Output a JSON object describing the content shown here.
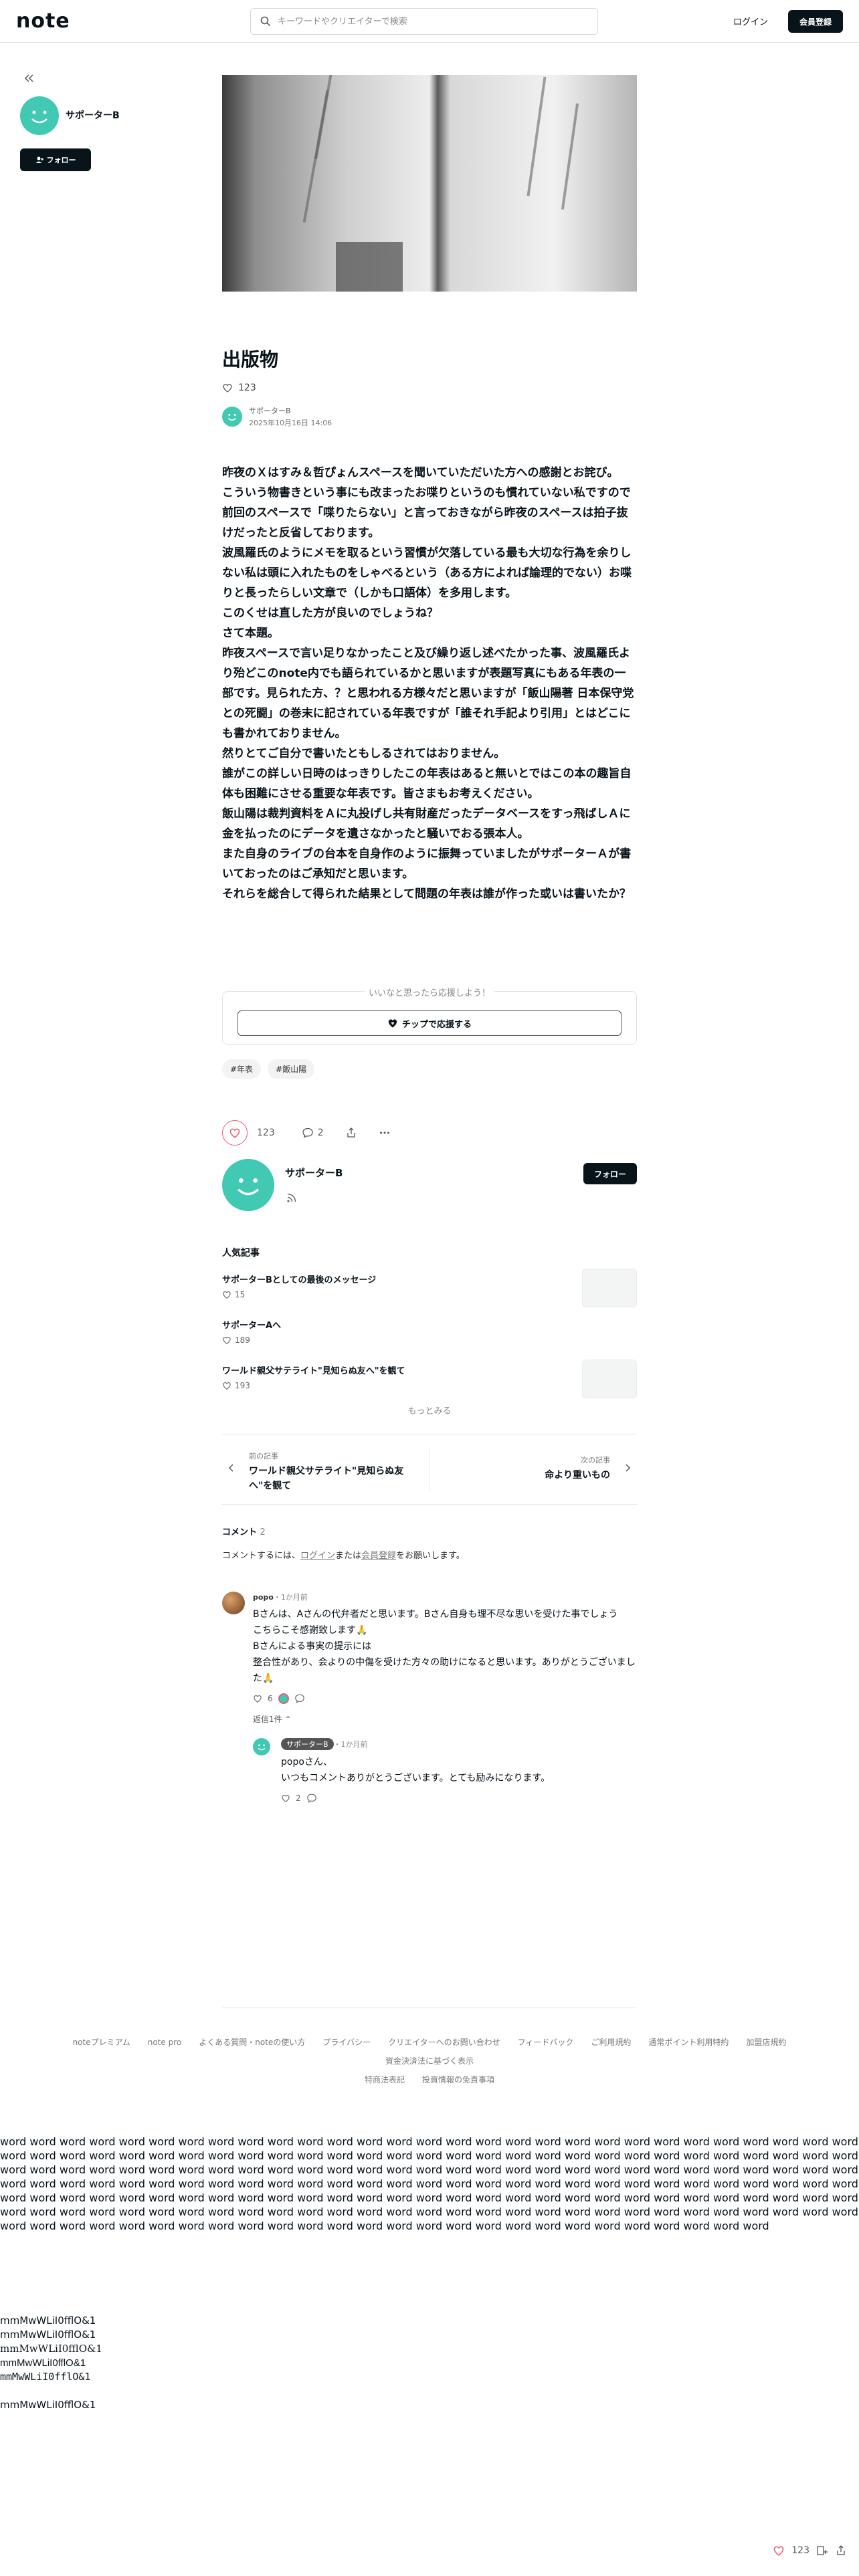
{
  "header": {
    "logo": "note",
    "search_placeholder": "キーワードやクリエイターで検索",
    "login": "ログイン",
    "signup": "会員登録"
  },
  "sidebar": {
    "creator_name": "サポーターB",
    "follow": "フォロー"
  },
  "article": {
    "title": "出版物",
    "likes": "123",
    "author": "サポーターB",
    "date": "2025年10月16日 14:06",
    "paragraphs": [
      "昨夜のＸはすみ＆哲ぴょんスペースを聞いていただいた方への感謝とお詫び。",
      "こういう物書きという事にも改まったお喋りというのも慣れていない私ですので前回のスペースで「喋りたらない」と言っておきながら昨夜のスペースは拍子抜けだったと反省しております。",
      "波風羅氏のようにメモを取るという習慣が欠落している最も大切な行為を余りしない私は頭に入れたものをしゃべるという（ある方によれば論理的でない）お喋りと長ったらしい文章で（しかも口語体）を多用します。",
      "このくせは直した方が良いのでしょうね？",
      "さて本題。",
      "昨夜スペースで言い足りなかったこと及び繰り返し述べたかった事、波風羅氏より殆どこのnote内でも語られているかと思いますが表題写真にもある年表の一部です。見られた方、？と思われる方様々だと思いますが「飯山陽著 日本保守党との死闘」の巻末に記されている年表ですが「誰それ手記より引用」とはどこにも書かれておりません。",
      "然りとてご自分で書いたともしるされてはおりません。",
      "誰がこの詳しい日時のはっきりしたこの年表はあると無いとではこの本の趣旨自体も困難にさせる重要な年表です。皆さまもお考えください。",
      "飯山陽は裁判資料をＡに丸投げし共有財産だったデータベースをすっ飛ばしＡに金を払ったのにデータを遺さなかったと騒いでおる張本人。",
      "また自身のライブの台本を自身作のように振舞っていましたがサポーターＡが書いておったのはご承知だと思います。",
      "それらを総合して得られた結果として問題の年表は誰が作った或いは書いたか？"
    ],
    "support_prompt": "いいなと思ったら応援しよう！",
    "support_button": "チップで応援する",
    "tags": [
      "#年表",
      "#飯山陽"
    ],
    "like_count": "123",
    "comment_count": "2"
  },
  "creator_card": {
    "name": "サポーターB",
    "follow": "フォロー",
    "popular_heading": "人気記事",
    "popular": [
      {
        "title": "サポーターBとしての最後のメッセージ",
        "likes": "15"
      },
      {
        "title": "サポーターAへ",
        "likes": "189"
      },
      {
        "title": "ワールド親父サテライト\"見知らぬ友へ\"を観て",
        "likes": "193"
      }
    ],
    "more": "もっとみる"
  },
  "nav": {
    "prev_label": "前の記事",
    "prev_title": "ワールド親父サテライト\"見知らぬ友へ\"を観て",
    "next_label": "次の記事",
    "next_title": "命より重いもの"
  },
  "comments": {
    "heading": "コメント",
    "count": "2",
    "note_prefix": "コメントするには、",
    "login": "ログイン",
    "middle": "または",
    "signup": "会員登録",
    "note_suffix": "をお願いします。",
    "items": [
      {
        "user": "popo",
        "time": "・1か月前",
        "lines": [
          "Bさんは、Aさんの代弁者だと思います。Bさん自身も理不尽な思いを受けた事でしょう",
          "こちらこそ感謝致します🙏",
          "Bさんによる事実の提示には",
          "整合性があり、会よりの中傷を受けた方々の助けになると思います。ありがとうございました🙏"
        ],
        "likes": "6",
        "reply_toggle": "返信1件"
      }
    ],
    "reply": {
      "user": "サポーターB",
      "time": "・1か月前",
      "lines": [
        "popoさん、",
        "いつもコメントありがとうございます。とても励みになります。"
      ],
      "likes": "2"
    }
  },
  "footer": {
    "links": [
      "noteプレミアム",
      "note pro",
      "よくある質問・noteの使い方",
      "プライバシー",
      "クリエイターへのお問い合わせ",
      "フィードバック",
      "ご利用規約",
      "通常ポイント利用特約",
      "加盟店規約",
      "資金決済法に基づく表示",
      "特商法表記",
      "投資情報の免責事項"
    ]
  },
  "test_text": {
    "words": "word word word word word word word word word word word word word word word word word word word word word word word word word word word word word word word word word word word word word word word word word word word word word word word word word word word word word word word word word word word word word word word word word word word word word word word word word word word word word word word word word word word word word word word word word word word word word word word word word word word word word word word word word word word word word word word word word word word word word word word word word word word word word word word word word word word word word word word word word word word word word word word word word word word word word word word word word word word word word word word word word word word word word word word word word word word word word word word word word word word word word word word word word word word word word word word word word word word word word word word word",
    "lines": [
      "mmMwWLiI0fflO&1",
      "mmMwWLiI0fflO&1",
      "mmMwWLiI0fflO&1",
      "mmMwWLiI0fflO&1",
      "mmMwWLiI0fflO&1",
      "mmMwWLiI0fflO&1"
    ]
  },
  "floating": {
    "likes": "123"
  }
}
